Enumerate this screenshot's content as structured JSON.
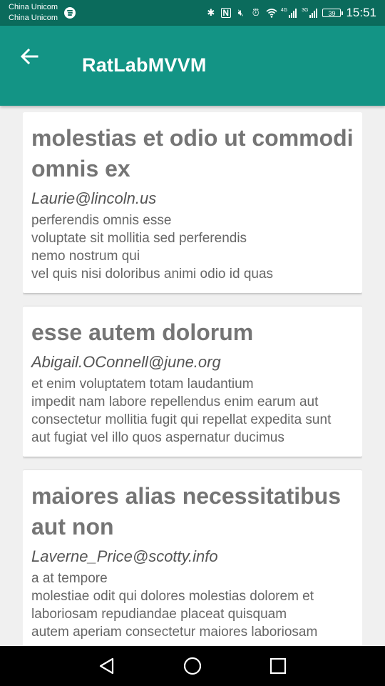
{
  "status_bar": {
    "carrier_1": "China Unicom",
    "carrier_2": "China Unicom",
    "network_1": "4G",
    "network_2": "3G",
    "battery": "39",
    "time": "15:51"
  },
  "app_bar": {
    "title": "RatLabMVVM",
    "back_icon": "arrow-back-icon"
  },
  "posts": [
    {
      "title": "molestias et odio ut commodi omnis ex",
      "email": "Laurie@lincoln.us",
      "body": "perferendis omnis esse\nvoluptate sit mollitia sed perferendis\nnemo nostrum qui\nvel quis nisi doloribus animi odio id quas"
    },
    {
      "title": "esse autem dolorum",
      "email": "Abigail.OConnell@june.org",
      "body": "et enim voluptatem totam laudantium\nimpedit nam labore repellendus enim earum aut\nconsectetur mollitia fugit qui repellat expedita sunt\naut fugiat vel illo quos aspernatur ducimus"
    },
    {
      "title": "maiores alias necessitatibus aut non",
      "email": "Laverne_Price@scotty.info",
      "body": "a at tempore\nmolestiae odit qui dolores molestias dolorem et\nlaboriosam repudiandae placeat quisquam\nautem aperiam consectetur maiores laboriosam"
    }
  ],
  "colors": {
    "status_bar": "#0b6b5c",
    "app_bar": "#139485",
    "background": "#f0f0f0",
    "card": "#ffffff"
  }
}
